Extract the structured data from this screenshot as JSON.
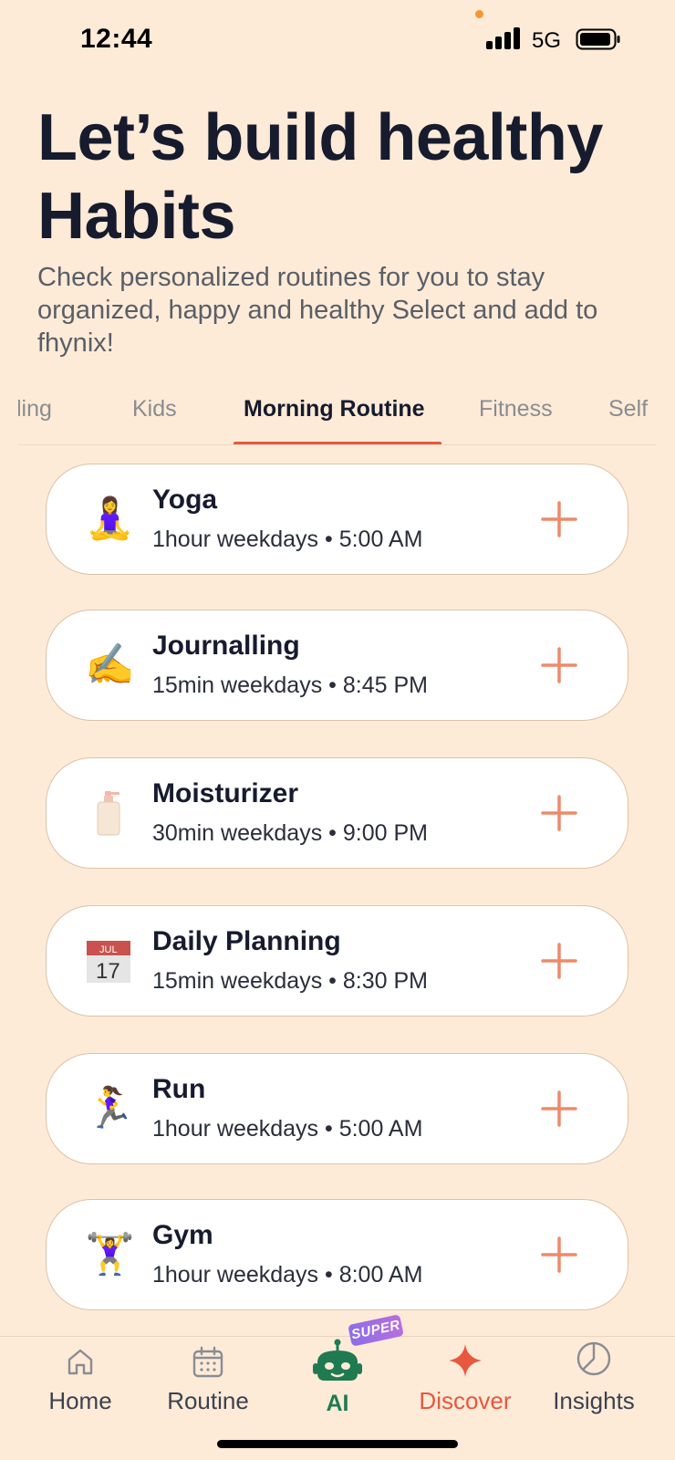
{
  "status_bar": {
    "time": "12:44",
    "network": "5G"
  },
  "header": {
    "title": "Let’s build healthy Habits",
    "subtitle": "Check personalized routines for you to stay organized, happy and healthy Select and add to fhynix!"
  },
  "tabs": [
    {
      "label": "ling"
    },
    {
      "label": "Kids"
    },
    {
      "label": "Morning Routine",
      "active": true
    },
    {
      "label": "Fitness"
    },
    {
      "label": "Self"
    }
  ],
  "habits": [
    {
      "title": "Yoga",
      "detail": "1hour weekdays • 5:00 AM",
      "icon": "woman-in-lotus-position-icon",
      "glyph": "🧘‍♀️"
    },
    {
      "title": "Journalling",
      "detail": "15min weekdays • 8:45 PM",
      "icon": "writing-hand-icon",
      "glyph": "✍️"
    },
    {
      "title": "Moisturizer",
      "detail": "30min weekdays • 9:00 PM",
      "icon": "lotion-bottle-icon",
      "glyph": "🧴"
    },
    {
      "title": "Daily Planning",
      "detail": "15min weekdays • 8:30 PM",
      "icon": "calendar-icon",
      "glyph": "📅"
    },
    {
      "title": "Run",
      "detail": "1hour weekdays • 5:00 AM",
      "icon": "woman-running-icon",
      "glyph": "🏃‍♀️"
    },
    {
      "title": "Gym",
      "detail": "1hour weekdays • 8:00 AM",
      "icon": "woman-lifting-weights-icon",
      "glyph": "🏋️‍♀️"
    }
  ],
  "calendar_icon": {
    "month": "JUL",
    "day": "17"
  },
  "bottom_nav": {
    "items": [
      {
        "label": "Home",
        "icon": "home-icon"
      },
      {
        "label": "Routine",
        "icon": "calendar-grid-icon"
      },
      {
        "label": "AI",
        "icon": "robot-icon",
        "badge": "SUPER"
      },
      {
        "label": "Discover",
        "icon": "sparkle-icon",
        "active": true
      },
      {
        "label": "Insights",
        "icon": "pie-chart-icon"
      }
    ]
  },
  "colors": {
    "background": "#fdebd8",
    "accent": "#e8573f",
    "plus": "#ee8a6a",
    "ai_green": "#1f7a52",
    "text_dark": "#161b2e"
  }
}
